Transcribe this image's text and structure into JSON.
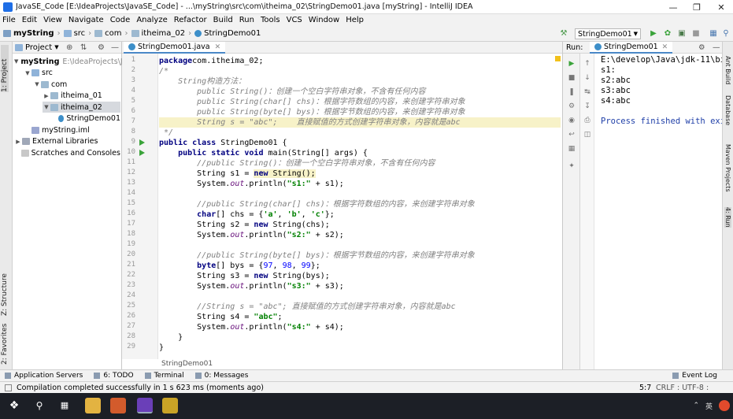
{
  "window": {
    "title": "JavaSE_Code [E:\\IdeaProjects\\JavaSE_Code] - ...\\myString\\src\\com\\itheima_02\\StringDemo01.java [myString] - IntelliJ IDEA"
  },
  "menu": [
    "File",
    "Edit",
    "View",
    "Navigate",
    "Code",
    "Analyze",
    "Refactor",
    "Build",
    "Run",
    "Tools",
    "VCS",
    "Window",
    "Help"
  ],
  "breadcrumbs": [
    "myString",
    "src",
    "com",
    "itheima_02",
    "StringDemo01"
  ],
  "run_config": "StringDemo01",
  "left_strip": {
    "project": "1: Project",
    "structure": "Z: Structure",
    "favorites": "2: Favorites"
  },
  "project": {
    "header": "Project",
    "tree": [
      {
        "label": "myString",
        "suffix": "E:\\IdeaProjects\\Ja",
        "depth": 0,
        "arrow": "down",
        "icon": "root"
      },
      {
        "label": "src",
        "suffix": "",
        "depth": 1,
        "arrow": "down",
        "icon": "folder"
      },
      {
        "label": "com",
        "suffix": "",
        "depth": 2,
        "arrow": "down",
        "icon": "pkg"
      },
      {
        "label": "itheima_01",
        "suffix": "",
        "depth": 3,
        "arrow": "right",
        "icon": "pkg"
      },
      {
        "label": "itheima_02",
        "suffix": "",
        "depth": 3,
        "arrow": "down",
        "icon": "pkg",
        "selected": true
      },
      {
        "label": "StringDemo01",
        "suffix": "",
        "depth": 4,
        "arrow": "",
        "icon": "class"
      },
      {
        "label": "myString.iml",
        "suffix": "",
        "depth": 1,
        "arrow": "",
        "icon": "iml"
      },
      {
        "label": "External Libraries",
        "suffix": "",
        "depth": 0,
        "arrow": "right",
        "icon": "lib"
      },
      {
        "label": "Scratches and Consoles",
        "suffix": "",
        "depth": 0,
        "arrow": "",
        "icon": "scratch"
      }
    ]
  },
  "editor": {
    "tab": "StringDemo01.java",
    "footer_crumb": "StringDemo01",
    "lines": [
      [
        [
          "kw",
          "package"
        ],
        [
          "",
          "com.itheima_02;"
        ]
      ],
      [
        [
          "cm",
          "/*"
        ]
      ],
      [
        [
          "cm",
          "    String构造方法："
        ]
      ],
      [
        [
          "cm",
          "        public String()：创建一个空白字符串对象，不含有任何内容"
        ]
      ],
      [
        [
          "cm",
          "        public String(char[] chs)：根据字符数组的内容，来创建字符串对象"
        ]
      ],
      [
        [
          "cm",
          "        public String(byte[] bys)：根据字节数组的内容，来创建字符串对象"
        ]
      ],
      [
        [
          "cm",
          "        String s = \"abc\";    直接赋值的方式创建字符串对象，内容就是abc"
        ]
      ],
      [
        [
          "cm",
          " */"
        ]
      ],
      [
        [
          "kw",
          "public class "
        ],
        [
          "",
          "StringDemo01 {"
        ]
      ],
      [
        [
          "",
          "    "
        ],
        [
          "kw",
          "public static void "
        ],
        [
          "",
          "main(String[] args) {"
        ]
      ],
      [
        [
          "cm",
          "        //public String()：创建一个空白字符串对象，不含有任何内容"
        ]
      ],
      [
        [
          "",
          "        String s1 = "
        ],
        [
          "kw",
          "new "
        ],
        [
          "",
          "String();"
        ]
      ],
      [
        [
          "",
          "        System."
        ],
        [
          "fld",
          "out"
        ],
        [
          "",
          ".println("
        ],
        [
          "str",
          "\"s1:\""
        ],
        [
          "",
          " + s1);"
        ]
      ],
      [
        [
          "",
          ""
        ]
      ],
      [
        [
          "cm",
          "        //public String(char[] chs)：根据字符数组的内容，来创建字符串对象"
        ]
      ],
      [
        [
          "kw",
          "        char"
        ],
        [
          "",
          "[] chs = {"
        ],
        [
          "str",
          "'a'"
        ],
        [
          "",
          ", "
        ],
        [
          "str",
          "'b'"
        ],
        [
          "",
          ", "
        ],
        [
          "str",
          "'c'"
        ],
        [
          "",
          "};"
        ]
      ],
      [
        [
          "",
          "        String s2 = "
        ],
        [
          "kw",
          "new "
        ],
        [
          "",
          "String(chs);"
        ]
      ],
      [
        [
          "",
          "        System."
        ],
        [
          "fld",
          "out"
        ],
        [
          "",
          ".println("
        ],
        [
          "str",
          "\"s2:\""
        ],
        [
          "",
          " + s2);"
        ]
      ],
      [
        [
          "",
          ""
        ]
      ],
      [
        [
          "cm",
          "        //public String(byte[] bys)：根据字节数组的内容，来创建字符串对象"
        ]
      ],
      [
        [
          "kw",
          "        byte"
        ],
        [
          "",
          "[] bys = {"
        ],
        [
          "num",
          "97"
        ],
        [
          "",
          ", "
        ],
        [
          "num",
          "98"
        ],
        [
          "",
          ", "
        ],
        [
          "num",
          "99"
        ],
        [
          "",
          "};"
        ]
      ],
      [
        [
          "",
          "        String s3 = "
        ],
        [
          "kw",
          "new "
        ],
        [
          "",
          "String(bys);"
        ]
      ],
      [
        [
          "",
          "        System."
        ],
        [
          "fld",
          "out"
        ],
        [
          "",
          ".println("
        ],
        [
          "str",
          "\"s3:\""
        ],
        [
          "",
          " + s3);"
        ]
      ],
      [
        [
          "",
          ""
        ]
      ],
      [
        [
          "cm",
          "        //String s = \"abc\"; 直接赋值的方式创建字符串对象，内容就是abc"
        ]
      ],
      [
        [
          "",
          "        String s4 = "
        ],
        [
          "str",
          "\"abc\""
        ],
        [
          "",
          ";"
        ]
      ],
      [
        [
          "",
          "        System."
        ],
        [
          "fld",
          "out"
        ],
        [
          "",
          ".println("
        ],
        [
          "str",
          "\"s4:\""
        ],
        [
          "",
          " + s4);"
        ]
      ],
      [
        [
          "",
          "    }"
        ]
      ],
      [
        [
          "",
          "}"
        ]
      ]
    ]
  },
  "run": {
    "label": "Run:",
    "tab": "StringDemo01",
    "console": [
      "E:\\develop\\Java\\jdk-11\\bin",
      "s1:",
      "s2:abc",
      "s3:abc",
      "s4:abc",
      "",
      "Process finished with exit"
    ]
  },
  "right_strip": {
    "ant": "Ant Build",
    "database": "Database",
    "maven": "Maven Projects",
    "run": "4: Run"
  },
  "bottom_tools": [
    "Application Servers",
    "6: TODO",
    "Terminal",
    "0: Messages"
  ],
  "event_log": "Event Log",
  "status": {
    "message": "Compilation completed successfully in 1 s 623 ms (moments ago)",
    "position": "5:7",
    "encoding": "CRLF : UTF-8 :"
  },
  "tray": {
    "language": "英"
  }
}
